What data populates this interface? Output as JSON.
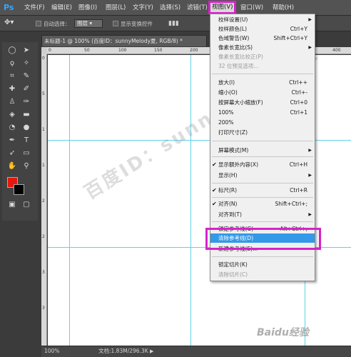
{
  "app": {
    "logo": "Ps"
  },
  "menubar": [
    {
      "id": "file",
      "label": "文件(F)"
    },
    {
      "id": "edit",
      "label": "编辑(E)"
    },
    {
      "id": "image",
      "label": "图像(I)"
    },
    {
      "id": "layer",
      "label": "图层(L)"
    },
    {
      "id": "type",
      "label": "文字(Y)"
    },
    {
      "id": "select",
      "label": "选择(S)"
    },
    {
      "id": "filter",
      "label": "滤镜(T)"
    },
    {
      "id": "view",
      "label": "视图(V)"
    },
    {
      "id": "window",
      "label": "窗口(W)"
    },
    {
      "id": "help",
      "label": "帮助(H)"
    }
  ],
  "optbar": {
    "auto_select_label": "自动选择：",
    "auto_select_value": "图层",
    "transform_label": "显示变换控件"
  },
  "document": {
    "tab_title": "未标题-1 @ 100% (百度ID：sunnyMelody夏, RGB/8) *",
    "zoom": "100%",
    "doc_info": "文档:1.83M/296.3K"
  },
  "ruler_top_ticks": [
    "0",
    "50",
    "100",
    "150",
    "200",
    "250",
    "300",
    "350",
    "400"
  ],
  "ruler_left_ticks": [
    "0",
    "5",
    "1",
    "1",
    "2",
    "2",
    "3",
    "3"
  ],
  "view_menu": [
    {
      "label": "校样设置(U)",
      "shortcut": "",
      "submenu": true,
      "disabled": false,
      "checked": false
    },
    {
      "label": "校样颜色(L)",
      "shortcut": "Ctrl+Y",
      "submenu": false,
      "disabled": false,
      "checked": false
    },
    {
      "label": "色域警告(W)",
      "shortcut": "Shift+Ctrl+Y",
      "submenu": false,
      "disabled": false,
      "checked": false
    },
    {
      "label": "像素长宽比(S)",
      "shortcut": "",
      "submenu": true,
      "disabled": false,
      "checked": false
    },
    {
      "label": "像素长宽比校正(P)",
      "shortcut": "",
      "submenu": false,
      "disabled": true,
      "checked": false
    },
    {
      "label": "32 位预览选项...",
      "shortcut": "",
      "submenu": false,
      "disabled": true,
      "checked": false
    },
    {
      "label": "放大(I)",
      "shortcut": "Ctrl++",
      "submenu": false,
      "disabled": false,
      "checked": false
    },
    {
      "label": "缩小(O)",
      "shortcut": "Ctrl+-",
      "submenu": false,
      "disabled": false,
      "checked": false
    },
    {
      "label": "按屏幕大小缩放(F)",
      "shortcut": "Ctrl+0",
      "submenu": false,
      "disabled": false,
      "checked": false
    },
    {
      "label": "100%",
      "shortcut": "Ctrl+1",
      "submenu": false,
      "disabled": false,
      "checked": false
    },
    {
      "label": "200%",
      "shortcut": "",
      "submenu": false,
      "disabled": false,
      "checked": false
    },
    {
      "label": "打印尺寸(Z)",
      "shortcut": "",
      "submenu": false,
      "disabled": false,
      "checked": false
    },
    {
      "label": "屏幕模式(M)",
      "shortcut": "",
      "submenu": true,
      "disabled": false,
      "checked": false
    },
    {
      "label": "显示额外内容(X)",
      "shortcut": "Ctrl+H",
      "submenu": false,
      "disabled": false,
      "checked": true
    },
    {
      "label": "显示(H)",
      "shortcut": "",
      "submenu": true,
      "disabled": false,
      "checked": false
    },
    {
      "label": "标尺(R)",
      "shortcut": "Ctrl+R",
      "submenu": false,
      "disabled": false,
      "checked": true
    },
    {
      "label": "对齐(N)",
      "shortcut": "Shift+Ctrl+;",
      "submenu": false,
      "disabled": false,
      "checked": true
    },
    {
      "label": "对齐到(T)",
      "shortcut": "",
      "submenu": true,
      "disabled": false,
      "checked": false
    },
    {
      "label": "锁定参考线(G)",
      "shortcut": "Alt+Ctrl+;",
      "submenu": false,
      "disabled": false,
      "checked": false
    },
    {
      "label": "清除参考线(D)",
      "shortcut": "",
      "submenu": false,
      "disabled": false,
      "checked": false
    },
    {
      "label": "新建参考线(E)...",
      "shortcut": "",
      "submenu": false,
      "disabled": false,
      "checked": false
    },
    {
      "label": "锁定切片(K)",
      "shortcut": "",
      "submenu": false,
      "disabled": false,
      "checked": false
    },
    {
      "label": "清除切片(C)",
      "shortcut": "",
      "submenu": false,
      "disabled": true,
      "checked": false
    }
  ],
  "watermark": {
    "text": "百度ID：sunnyMelody夏",
    "baidu": "Baidu经验"
  },
  "colors": {
    "accent_highlight": "#d523c9",
    "menu_selected": "#3399e8",
    "guide": "#5fd3e6",
    "foreground": "#e4180f",
    "background": "#000000"
  }
}
